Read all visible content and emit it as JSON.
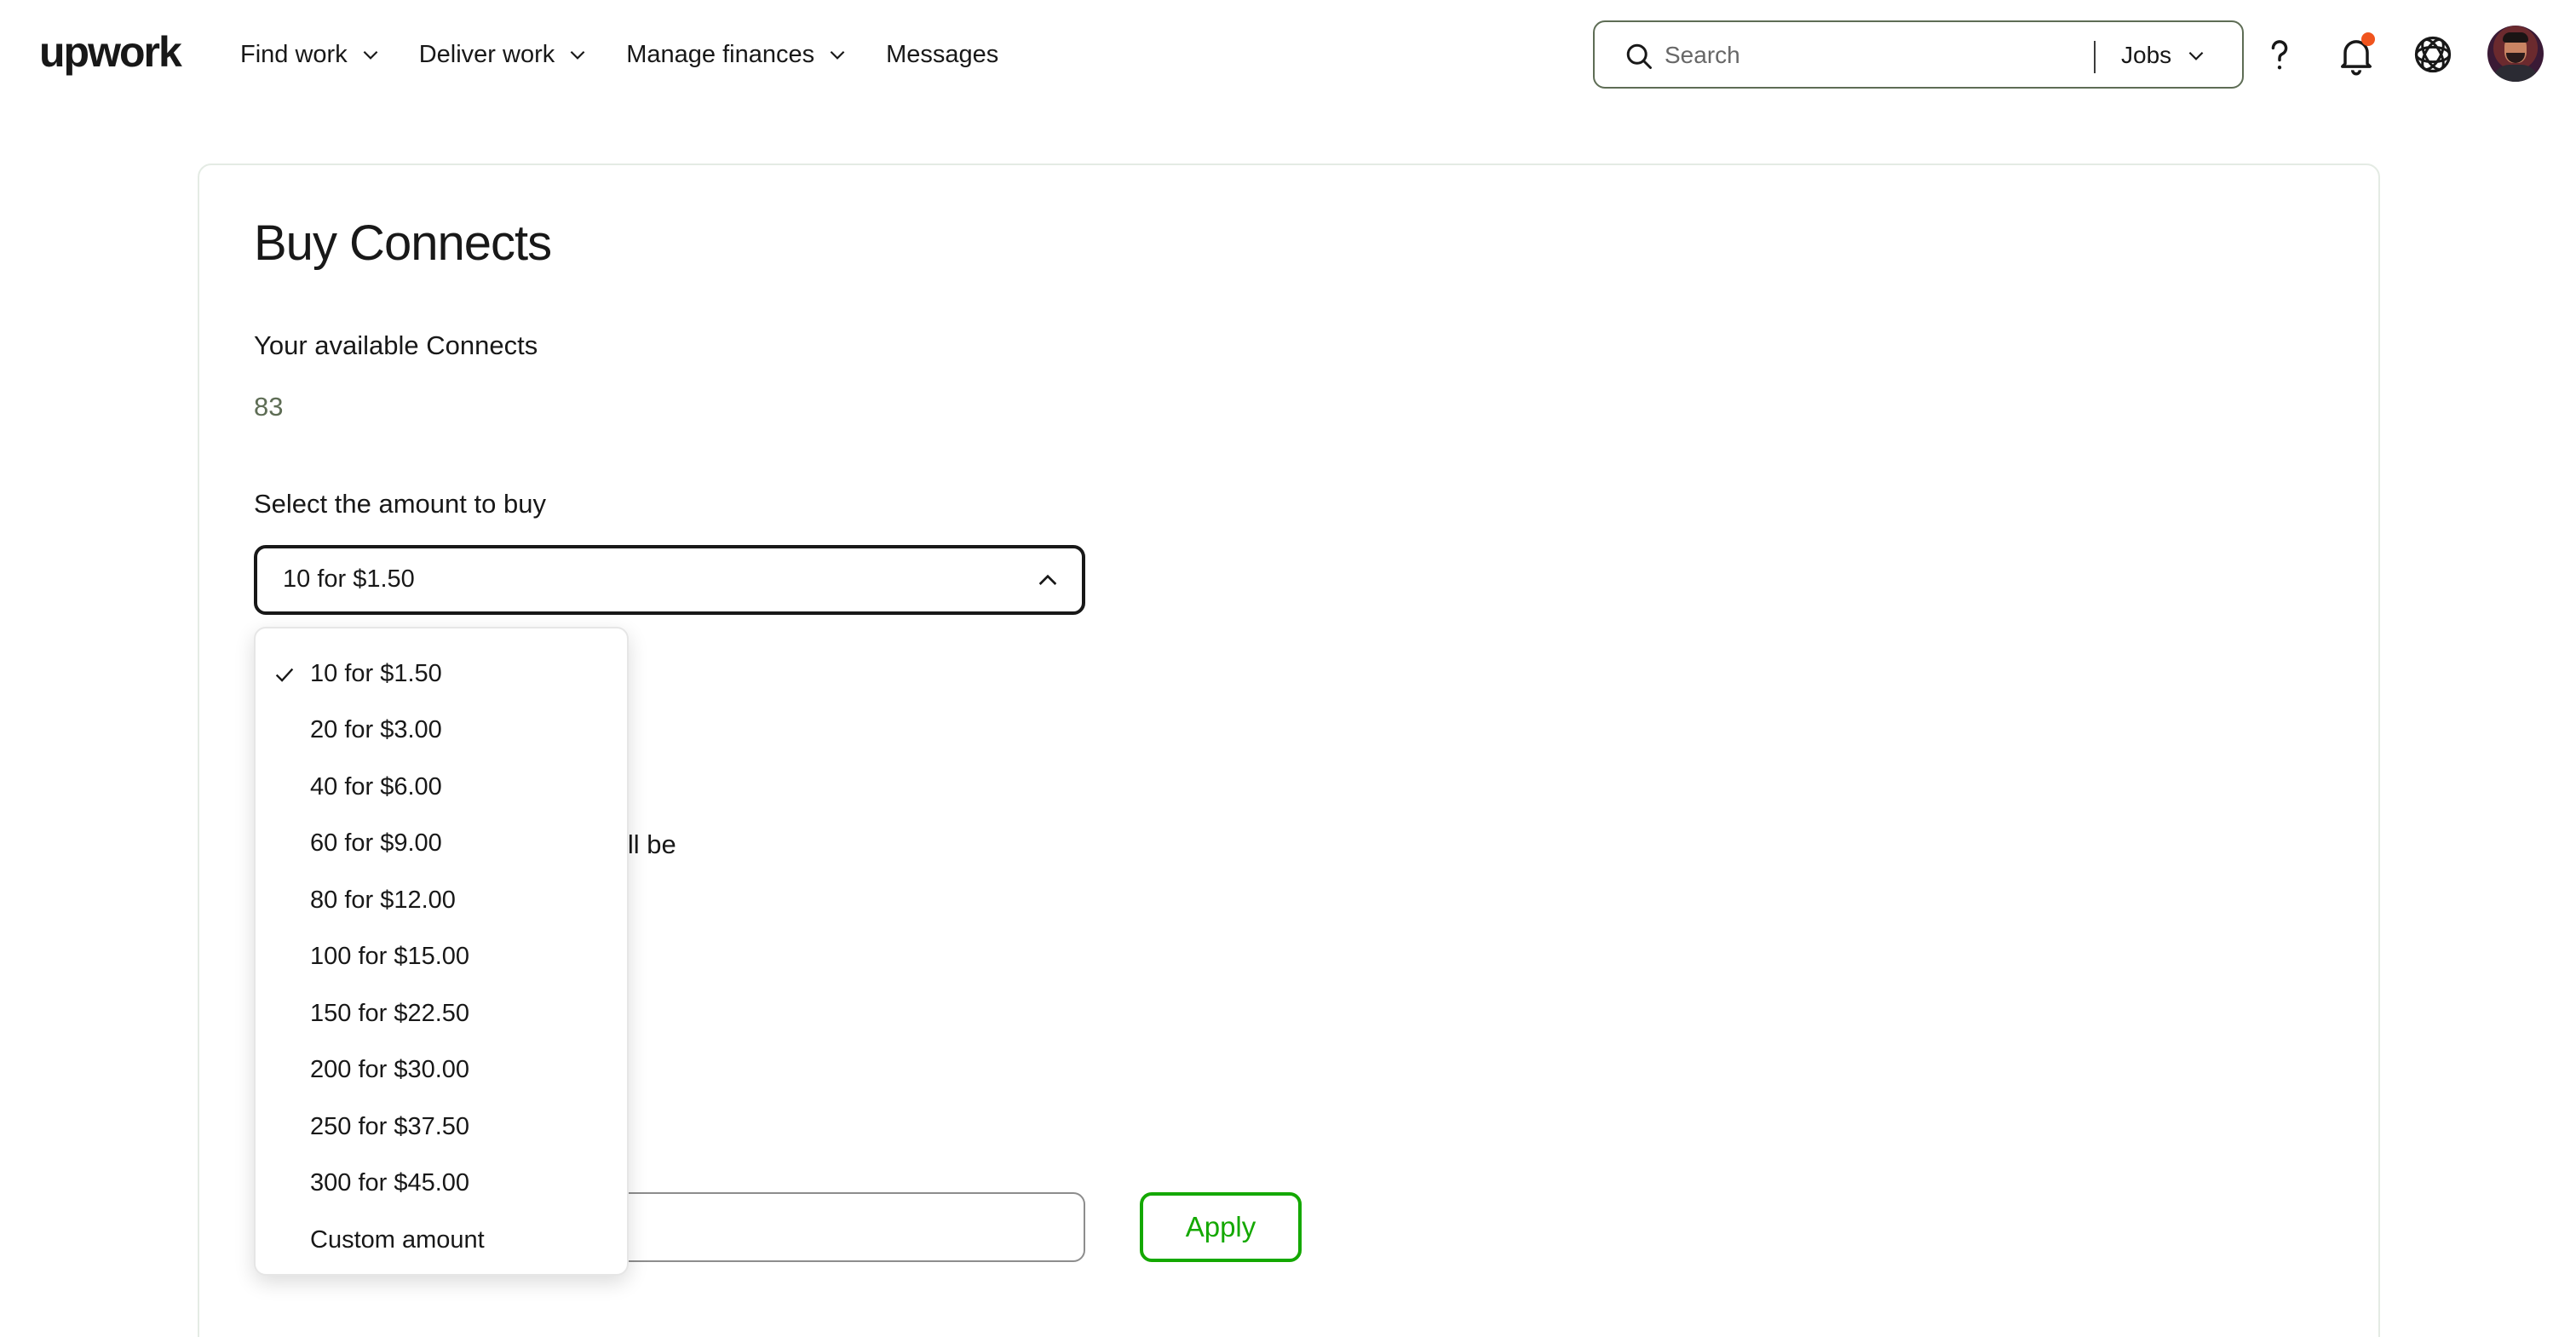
{
  "header": {
    "logo": "upwork",
    "nav": [
      {
        "label": "Find work",
        "has_dropdown": true
      },
      {
        "label": "Deliver work",
        "has_dropdown": true
      },
      {
        "label": "Manage finances",
        "has_dropdown": true
      },
      {
        "label": "Messages",
        "has_dropdown": false
      }
    ],
    "search": {
      "placeholder": "Search",
      "scope": "Jobs"
    },
    "icons": [
      "help-icon",
      "bell-icon",
      "apps-icon",
      "avatar"
    ],
    "notification_color": "#f0541e"
  },
  "main": {
    "title": "Buy Connects",
    "available_label": "Your available Connects",
    "available_value": "83",
    "select_label": "Select the amount to buy",
    "selected_value": "10 for $1.50",
    "partial_text": "ill be",
    "apply_label": "Apply",
    "accent_color": "#14a800"
  },
  "menu": {
    "options": [
      {
        "label": "10 for $1.50",
        "selected": true
      },
      {
        "label": "20 for $3.00",
        "selected": false
      },
      {
        "label": "40 for $6.00",
        "selected": false
      },
      {
        "label": "60 for $9.00",
        "selected": false
      },
      {
        "label": "80 for $12.00",
        "selected": false
      },
      {
        "label": "100 for $15.00",
        "selected": false
      },
      {
        "label": "150 for $22.50",
        "selected": false
      },
      {
        "label": "200 for $30.00",
        "selected": false
      },
      {
        "label": "250 for $37.50",
        "selected": false
      },
      {
        "label": "300 for $45.00",
        "selected": false
      },
      {
        "label": "Custom amount",
        "selected": false
      }
    ]
  }
}
